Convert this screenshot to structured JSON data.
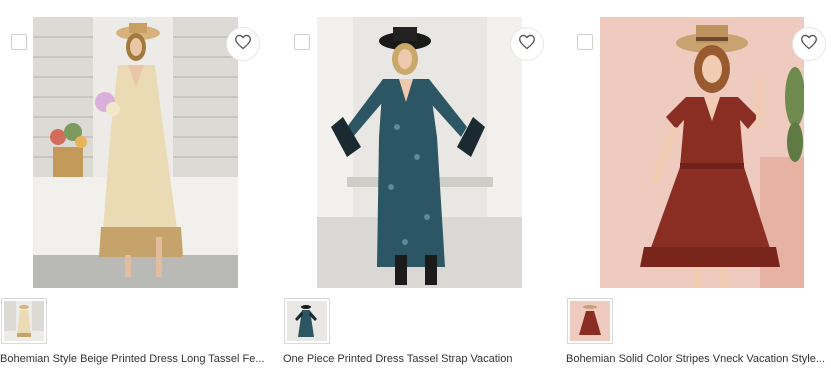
{
  "colors": {
    "favorite_icon_stroke": "#555555",
    "checkbox_border": "#cfcfcf",
    "title_text": "#333333"
  },
  "products": [
    {
      "title": "Bohemian Style Beige Printed Dress Long Tassel Fe...",
      "favorite_icon": "heart-outline-icon",
      "image_colors": {
        "background": "#e9e7e2",
        "dress": "#eadbb4",
        "accent": "#c6a36a"
      }
    },
    {
      "title": "One Piece Printed Dress Tassel Strap Vacation",
      "favorite_icon": "heart-outline-icon",
      "image_colors": {
        "background": "#e6e5e2",
        "dress": "#2c5663",
        "accent": "#1b2a30"
      }
    },
    {
      "title": "Bohemian Solid Color Stripes Vneck Vacation Style...",
      "favorite_icon": "heart-outline-icon",
      "image_colors": {
        "background": "#eec9bd",
        "dress": "#8a2e24",
        "accent": "#c9a36f"
      }
    }
  ]
}
